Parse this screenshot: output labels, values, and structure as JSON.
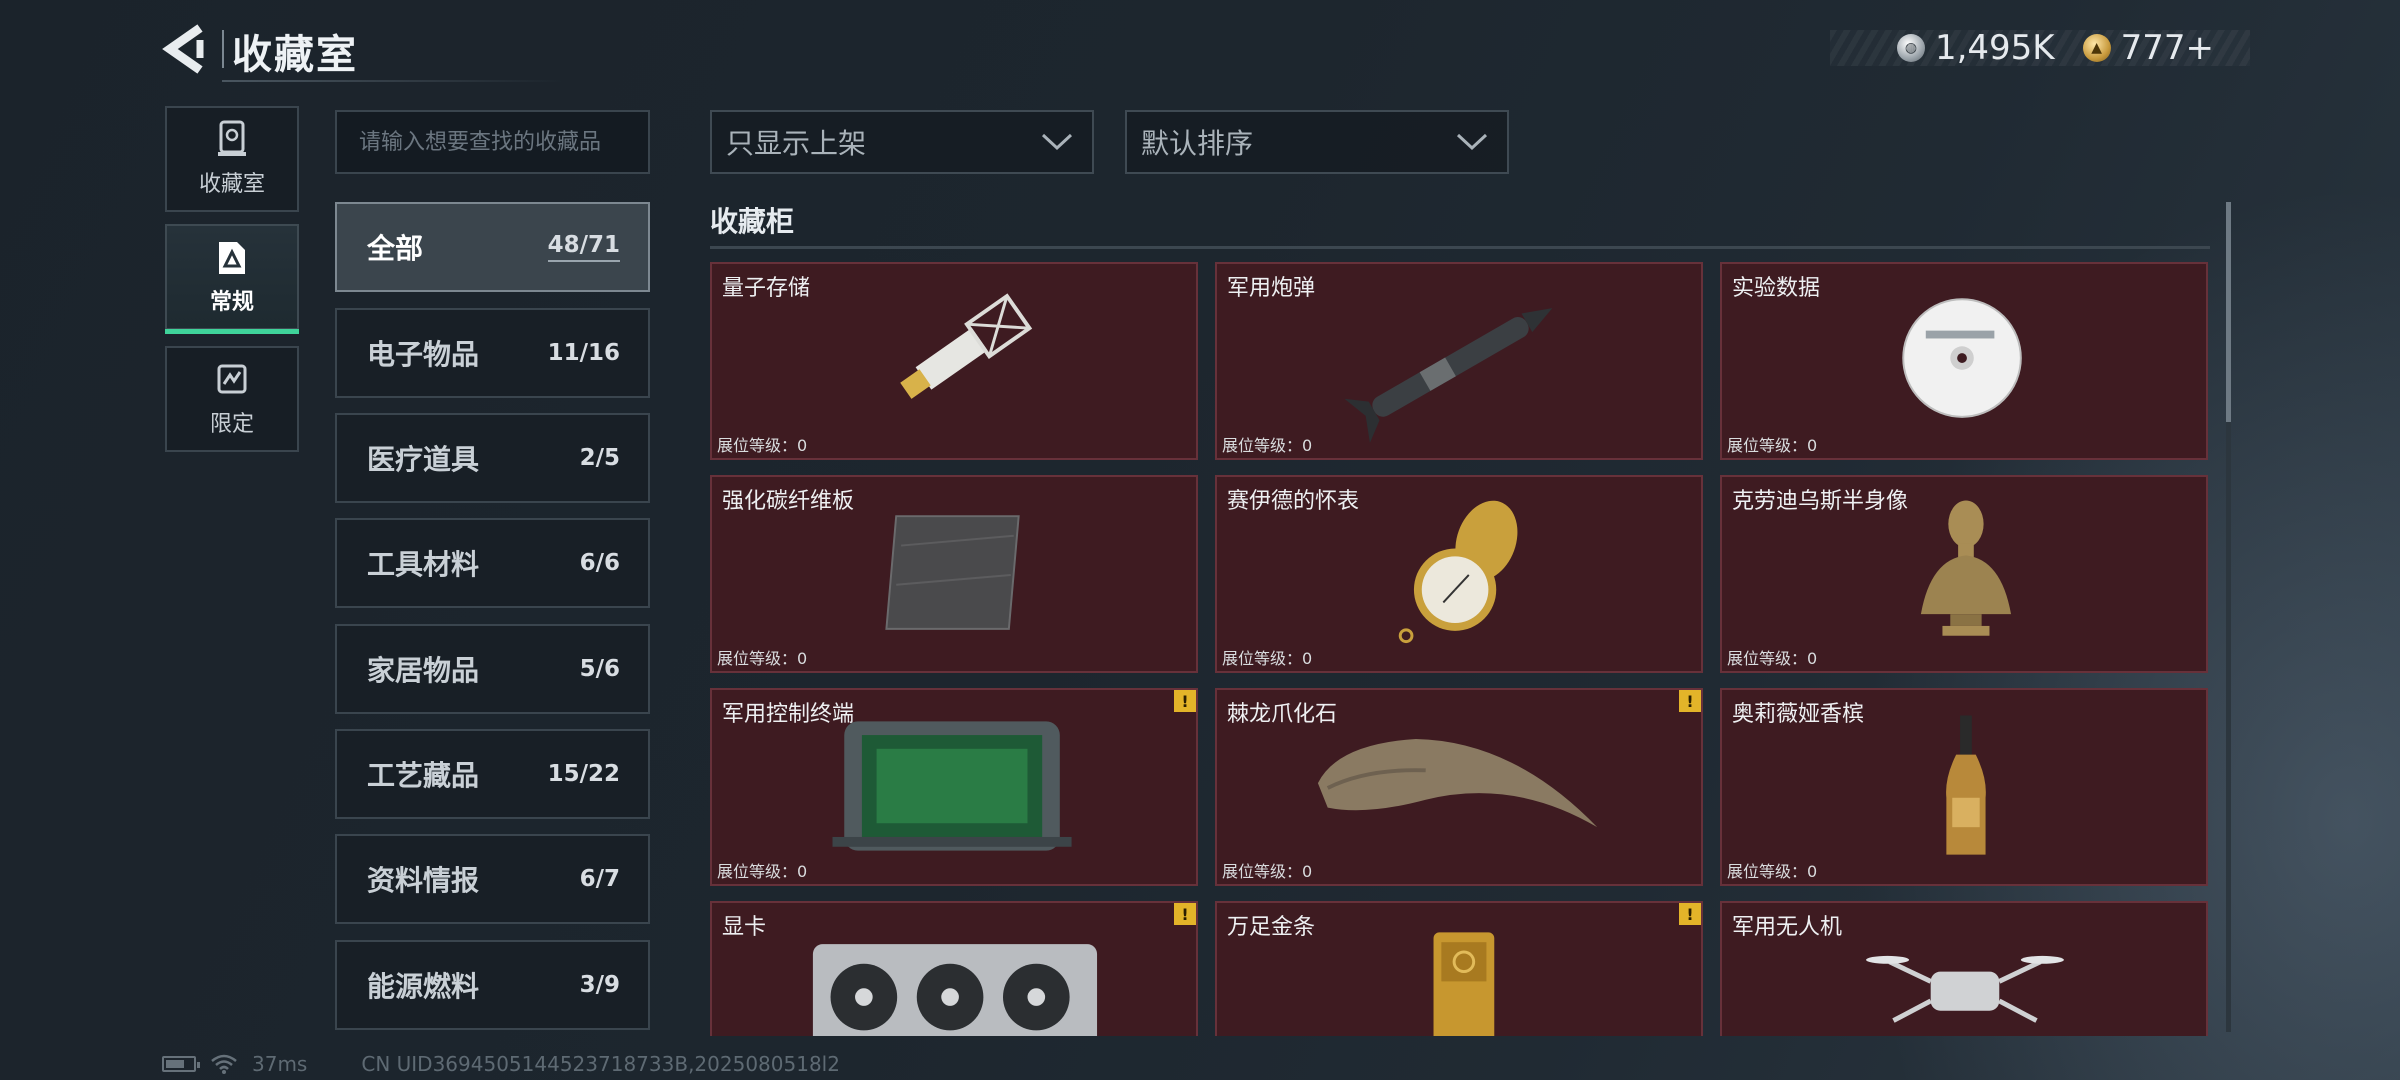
{
  "header": {
    "title": "收藏室"
  },
  "currency": [
    {
      "icon": "silver-coin-icon",
      "value": "1,495K"
    },
    {
      "icon": "gold-coin-icon",
      "value": "777+"
    }
  ],
  "nav": [
    {
      "label": "收藏室",
      "icon": "display-case-icon",
      "active": false
    },
    {
      "label": "常规",
      "icon": "regular-collection-icon",
      "active": true
    },
    {
      "label": "限定",
      "icon": "limited-collection-icon",
      "active": false
    }
  ],
  "search": {
    "placeholder": "请输入想要查找的收藏品"
  },
  "categories": [
    {
      "name": "全部",
      "count": "48/71",
      "active": true
    },
    {
      "name": "电子物品",
      "count": "11/16"
    },
    {
      "name": "医疗道具",
      "count": "2/5"
    },
    {
      "name": "工具材料",
      "count": "6/6"
    },
    {
      "name": "家居物品",
      "count": "5/6"
    },
    {
      "name": "工艺藏品",
      "count": "15/22"
    },
    {
      "name": "资料情报",
      "count": "6/7"
    },
    {
      "name": "能源燃料",
      "count": "3/9"
    }
  ],
  "filters": {
    "display": "只显示上架",
    "sort": "默认排序"
  },
  "section": {
    "title": "收藏柜"
  },
  "items": [
    {
      "name": "量子存储",
      "level": "展位等级：0",
      "warning": false,
      "icon": "quantum-storage-icon"
    },
    {
      "name": "军用炮弹",
      "level": "展位等级：0",
      "warning": false,
      "icon": "military-shell-icon"
    },
    {
      "name": "实验数据",
      "level": "展位等级：0",
      "warning": false,
      "icon": "data-disc-icon"
    },
    {
      "name": "强化碳纤维板",
      "level": "展位等级：0",
      "warning": false,
      "icon": "carbon-plate-icon"
    },
    {
      "name": "赛伊德的怀表",
      "level": "展位等级：0",
      "warning": false,
      "icon": "pocket-watch-icon"
    },
    {
      "name": "克劳迪乌斯半身像",
      "level": "展位等级：0",
      "warning": false,
      "icon": "bust-icon"
    },
    {
      "name": "军用控制终端",
      "level": "展位等级：0",
      "warning": true,
      "icon": "control-terminal-icon"
    },
    {
      "name": "棘龙爪化石",
      "level": "展位等级：0",
      "warning": true,
      "icon": "claw-fossil-icon"
    },
    {
      "name": "奥莉薇娅香槟",
      "level": "展位等级：0",
      "warning": false,
      "icon": "champagne-icon"
    },
    {
      "name": "显卡",
      "level": "",
      "warning": true,
      "icon": "graphics-card-icon"
    },
    {
      "name": "万足金条",
      "level": "",
      "warning": true,
      "icon": "gold-bar-icon"
    },
    {
      "name": "军用无人机",
      "level": "",
      "warning": false,
      "icon": "drone-icon"
    }
  ],
  "warning_symbol": "!",
  "footer": {
    "ping": "37ms",
    "uid": "CN UID3694505144523718733B,2025080518l2"
  },
  "colors": {
    "accent": "#3fd39a",
    "card_bg": "#3e1b21",
    "card_border": "#67313a",
    "warning": "#e3b429"
  }
}
